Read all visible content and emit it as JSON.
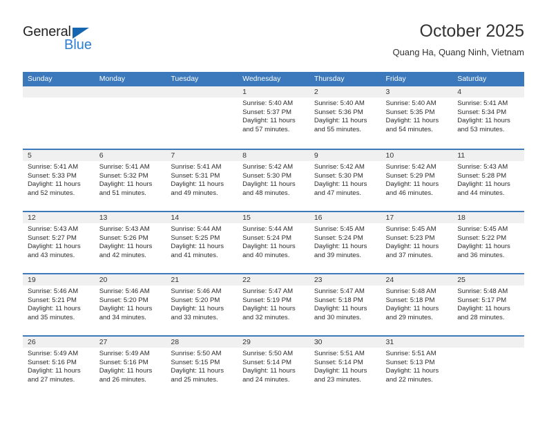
{
  "brand": {
    "name_part1": "General",
    "name_part2": "Blue",
    "accent_color": "#2a7fd4",
    "triangle_color": "#1565b0"
  },
  "header": {
    "title": "October 2025",
    "location": "Quang Ha, Quang Ninh, Vietnam"
  },
  "calendar": {
    "header_background": "#3b79bc",
    "day_band_background": "#f0f0f0",
    "weekdays": [
      "Sunday",
      "Monday",
      "Tuesday",
      "Wednesday",
      "Thursday",
      "Friday",
      "Saturday"
    ],
    "weeks": [
      [
        {
          "day": "",
          "lines": []
        },
        {
          "day": "",
          "lines": []
        },
        {
          "day": "",
          "lines": []
        },
        {
          "day": "1",
          "lines": [
            "Sunrise: 5:40 AM",
            "Sunset: 5:37 PM",
            "Daylight: 11 hours",
            "and 57 minutes."
          ]
        },
        {
          "day": "2",
          "lines": [
            "Sunrise: 5:40 AM",
            "Sunset: 5:36 PM",
            "Daylight: 11 hours",
            "and 55 minutes."
          ]
        },
        {
          "day": "3",
          "lines": [
            "Sunrise: 5:40 AM",
            "Sunset: 5:35 PM",
            "Daylight: 11 hours",
            "and 54 minutes."
          ]
        },
        {
          "day": "4",
          "lines": [
            "Sunrise: 5:41 AM",
            "Sunset: 5:34 PM",
            "Daylight: 11 hours",
            "and 53 minutes."
          ]
        }
      ],
      [
        {
          "day": "5",
          "lines": [
            "Sunrise: 5:41 AM",
            "Sunset: 5:33 PM",
            "Daylight: 11 hours",
            "and 52 minutes."
          ]
        },
        {
          "day": "6",
          "lines": [
            "Sunrise: 5:41 AM",
            "Sunset: 5:32 PM",
            "Daylight: 11 hours",
            "and 51 minutes."
          ]
        },
        {
          "day": "7",
          "lines": [
            "Sunrise: 5:41 AM",
            "Sunset: 5:31 PM",
            "Daylight: 11 hours",
            "and 49 minutes."
          ]
        },
        {
          "day": "8",
          "lines": [
            "Sunrise: 5:42 AM",
            "Sunset: 5:30 PM",
            "Daylight: 11 hours",
            "and 48 minutes."
          ]
        },
        {
          "day": "9",
          "lines": [
            "Sunrise: 5:42 AM",
            "Sunset: 5:30 PM",
            "Daylight: 11 hours",
            "and 47 minutes."
          ]
        },
        {
          "day": "10",
          "lines": [
            "Sunrise: 5:42 AM",
            "Sunset: 5:29 PM",
            "Daylight: 11 hours",
            "and 46 minutes."
          ]
        },
        {
          "day": "11",
          "lines": [
            "Sunrise: 5:43 AM",
            "Sunset: 5:28 PM",
            "Daylight: 11 hours",
            "and 44 minutes."
          ]
        }
      ],
      [
        {
          "day": "12",
          "lines": [
            "Sunrise: 5:43 AM",
            "Sunset: 5:27 PM",
            "Daylight: 11 hours",
            "and 43 minutes."
          ]
        },
        {
          "day": "13",
          "lines": [
            "Sunrise: 5:43 AM",
            "Sunset: 5:26 PM",
            "Daylight: 11 hours",
            "and 42 minutes."
          ]
        },
        {
          "day": "14",
          "lines": [
            "Sunrise: 5:44 AM",
            "Sunset: 5:25 PM",
            "Daylight: 11 hours",
            "and 41 minutes."
          ]
        },
        {
          "day": "15",
          "lines": [
            "Sunrise: 5:44 AM",
            "Sunset: 5:24 PM",
            "Daylight: 11 hours",
            "and 40 minutes."
          ]
        },
        {
          "day": "16",
          "lines": [
            "Sunrise: 5:45 AM",
            "Sunset: 5:24 PM",
            "Daylight: 11 hours",
            "and 39 minutes."
          ]
        },
        {
          "day": "17",
          "lines": [
            "Sunrise: 5:45 AM",
            "Sunset: 5:23 PM",
            "Daylight: 11 hours",
            "and 37 minutes."
          ]
        },
        {
          "day": "18",
          "lines": [
            "Sunrise: 5:45 AM",
            "Sunset: 5:22 PM",
            "Daylight: 11 hours",
            "and 36 minutes."
          ]
        }
      ],
      [
        {
          "day": "19",
          "lines": [
            "Sunrise: 5:46 AM",
            "Sunset: 5:21 PM",
            "Daylight: 11 hours",
            "and 35 minutes."
          ]
        },
        {
          "day": "20",
          "lines": [
            "Sunrise: 5:46 AM",
            "Sunset: 5:20 PM",
            "Daylight: 11 hours",
            "and 34 minutes."
          ]
        },
        {
          "day": "21",
          "lines": [
            "Sunrise: 5:46 AM",
            "Sunset: 5:20 PM",
            "Daylight: 11 hours",
            "and 33 minutes."
          ]
        },
        {
          "day": "22",
          "lines": [
            "Sunrise: 5:47 AM",
            "Sunset: 5:19 PM",
            "Daylight: 11 hours",
            "and 32 minutes."
          ]
        },
        {
          "day": "23",
          "lines": [
            "Sunrise: 5:47 AM",
            "Sunset: 5:18 PM",
            "Daylight: 11 hours",
            "and 30 minutes."
          ]
        },
        {
          "day": "24",
          "lines": [
            "Sunrise: 5:48 AM",
            "Sunset: 5:18 PM",
            "Daylight: 11 hours",
            "and 29 minutes."
          ]
        },
        {
          "day": "25",
          "lines": [
            "Sunrise: 5:48 AM",
            "Sunset: 5:17 PM",
            "Daylight: 11 hours",
            "and 28 minutes."
          ]
        }
      ],
      [
        {
          "day": "26",
          "lines": [
            "Sunrise: 5:49 AM",
            "Sunset: 5:16 PM",
            "Daylight: 11 hours",
            "and 27 minutes."
          ]
        },
        {
          "day": "27",
          "lines": [
            "Sunrise: 5:49 AM",
            "Sunset: 5:16 PM",
            "Daylight: 11 hours",
            "and 26 minutes."
          ]
        },
        {
          "day": "28",
          "lines": [
            "Sunrise: 5:50 AM",
            "Sunset: 5:15 PM",
            "Daylight: 11 hours",
            "and 25 minutes."
          ]
        },
        {
          "day": "29",
          "lines": [
            "Sunrise: 5:50 AM",
            "Sunset: 5:14 PM",
            "Daylight: 11 hours",
            "and 24 minutes."
          ]
        },
        {
          "day": "30",
          "lines": [
            "Sunrise: 5:51 AM",
            "Sunset: 5:14 PM",
            "Daylight: 11 hours",
            "and 23 minutes."
          ]
        },
        {
          "day": "31",
          "lines": [
            "Sunrise: 5:51 AM",
            "Sunset: 5:13 PM",
            "Daylight: 11 hours",
            "and 22 minutes."
          ]
        },
        {
          "day": "",
          "lines": []
        }
      ]
    ]
  }
}
